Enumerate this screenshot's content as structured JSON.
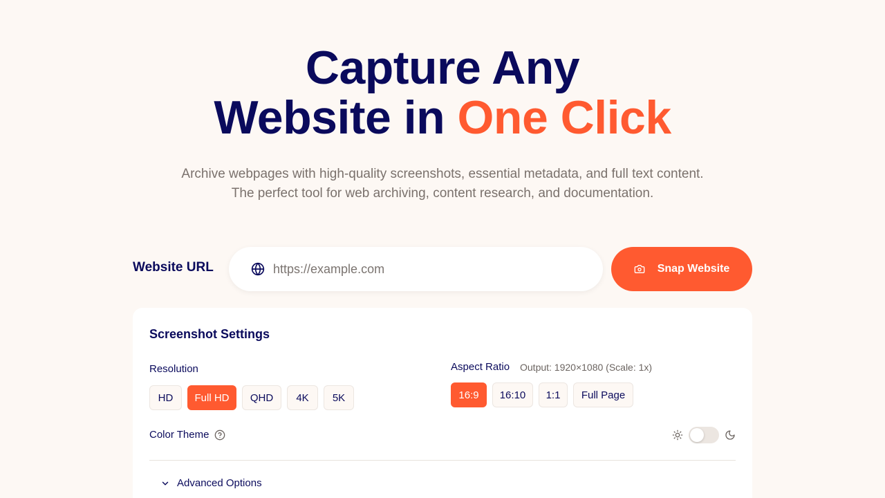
{
  "hero": {
    "title_line1": "Capture Any",
    "title_line2_prefix": "Website in ",
    "title_line2_accent": "One Click"
  },
  "subtitle": {
    "line1": "Archive webpages with high-quality screenshots, essential metadata, and full text content.",
    "line2": "The perfect tool for web archiving, content research, and documentation."
  },
  "url": {
    "label": "Website URL",
    "placeholder": "https://example.com",
    "value": ""
  },
  "snap_button": {
    "label": "Snap Website",
    "icon": "camera-icon"
  },
  "settings": {
    "title": "Screenshot Settings",
    "resolution": {
      "label": "Resolution",
      "options": [
        "HD",
        "Full HD",
        "QHD",
        "4K",
        "5K"
      ],
      "selected": "Full HD"
    },
    "aspect_ratio": {
      "label": "Aspect Ratio",
      "output_note": "Output: 1920×1080 (Scale: 1x)",
      "options": [
        "16:9",
        "16:10",
        "1:1",
        "Full Page"
      ],
      "selected": "16:9"
    },
    "color_theme": {
      "label": "Color Theme",
      "help_icon": "help-circle-icon",
      "light_icon": "sun-icon",
      "dark_icon": "moon-icon",
      "dark_mode": false
    },
    "advanced": {
      "label": "Advanced Options",
      "icon": "chevron-down-icon"
    }
  },
  "colors": {
    "accent": "#ff5a30",
    "navy": "#0a0a5c",
    "background": "#fdf8f4"
  }
}
